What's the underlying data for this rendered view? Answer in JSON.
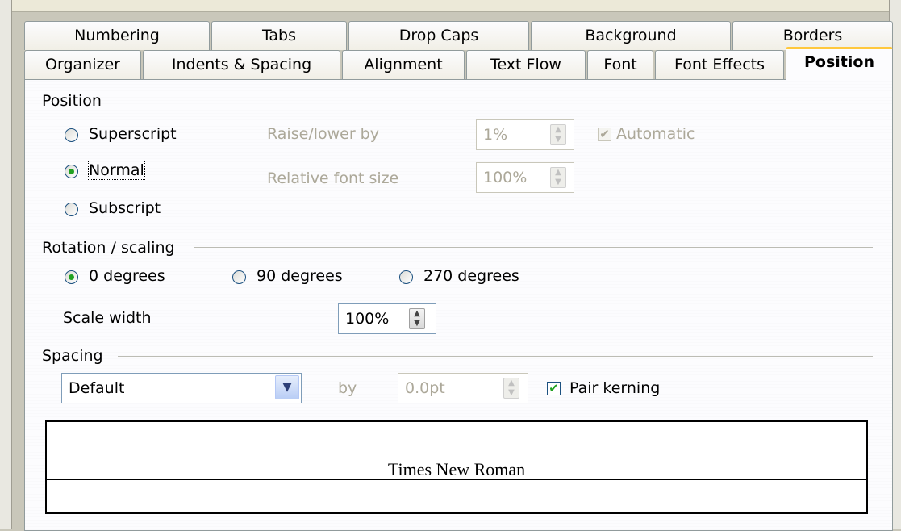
{
  "tabs_row1": [
    "Numbering",
    "Tabs",
    "Drop Caps",
    "Background",
    "Borders"
  ],
  "tabs_row2": [
    "Organizer",
    "Indents & Spacing",
    "Alignment",
    "Text Flow",
    "Font",
    "Font Effects",
    "Position"
  ],
  "active_tab": "Position",
  "position": {
    "title": "Position",
    "superscript": "Superscript",
    "normal": "Normal",
    "subscript": "Subscript",
    "selected": "Normal",
    "raise_lower_label": "Raise/lower by",
    "raise_lower_value": "1%",
    "automatic_label": "Automatic",
    "automatic_checked": true,
    "relative_font_label": "Relative font size",
    "relative_font_value": "100%"
  },
  "rotation": {
    "title": "Rotation / scaling",
    "deg0": "0 degrees",
    "deg90": "90 degrees",
    "deg270": "270 degrees",
    "selected": "0 degrees",
    "scale_width_label": "Scale width",
    "scale_width_value": "100%"
  },
  "spacing": {
    "title": "Spacing",
    "select_value": "Default",
    "by_label": "by",
    "by_value": "0.0pt",
    "pair_kerning_label": "Pair kerning",
    "pair_kerning_checked": true
  },
  "preview": {
    "text": "Times New Roman"
  },
  "colors": {
    "active_tab_accent": "#ffc83c",
    "radio_dot": "#21a121",
    "disabled_text": "#aca899"
  }
}
